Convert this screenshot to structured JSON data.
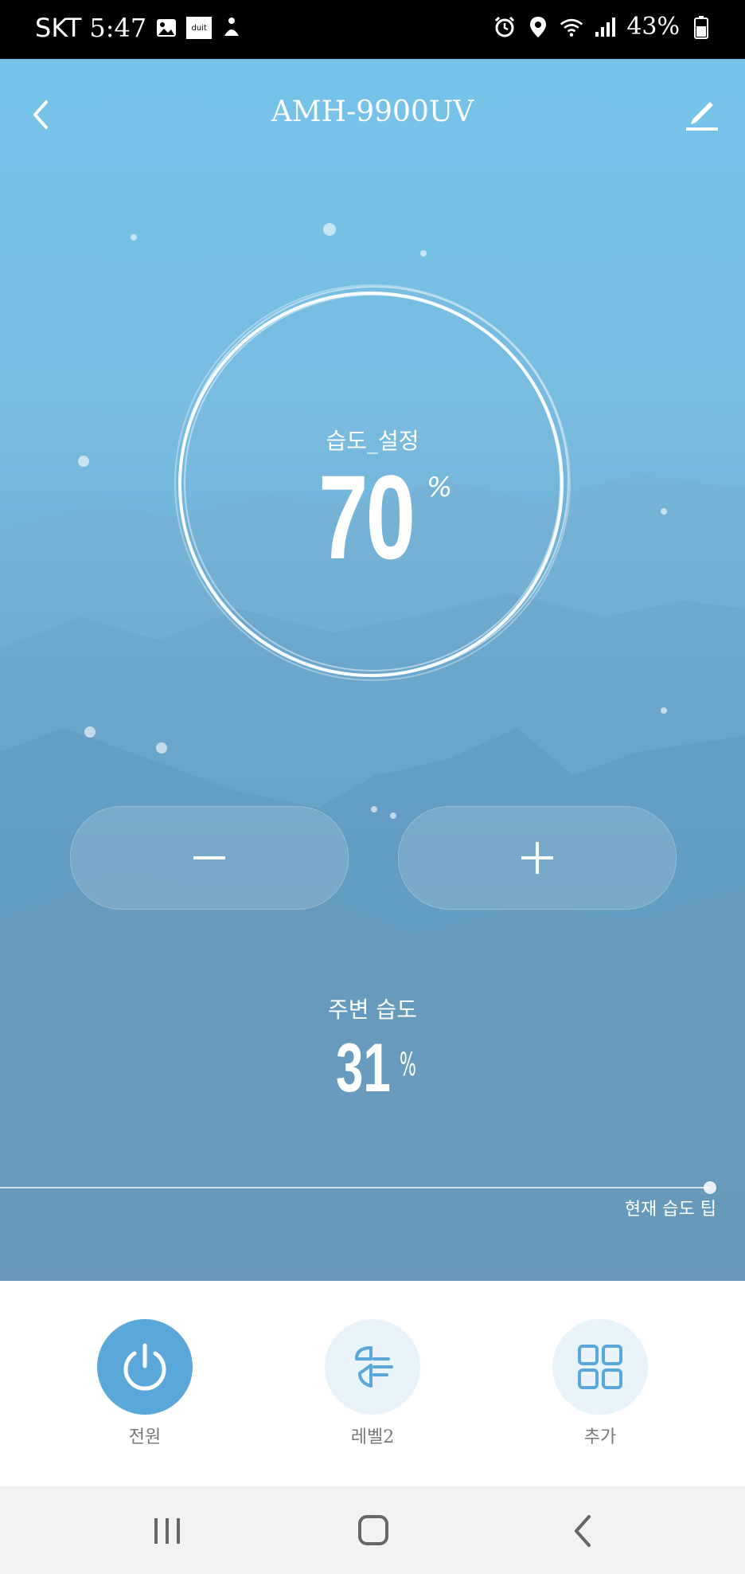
{
  "status_bar": {
    "carrier": "SKT",
    "time": "5:47",
    "app_badge": "duit",
    "battery": "43%"
  },
  "header": {
    "title": "AMH-9900UV"
  },
  "humidity_setting": {
    "label": "습도_설정",
    "value": "70",
    "unit": "%"
  },
  "ambient": {
    "label": "주변 습도",
    "value": "31",
    "unit": "%"
  },
  "tip": {
    "label": "현재 습도 팁"
  },
  "controls": [
    {
      "label": "전원",
      "icon": "power-icon",
      "active": true
    },
    {
      "label": "레벨2",
      "icon": "fan-level-icon",
      "active": false
    },
    {
      "label": "추가",
      "icon": "grid-icon",
      "active": false
    }
  ],
  "colors": {
    "accent": "#5aa7da",
    "inactive_circle": "#e8f3fa",
    "icon_blue": "#5aa7da"
  }
}
